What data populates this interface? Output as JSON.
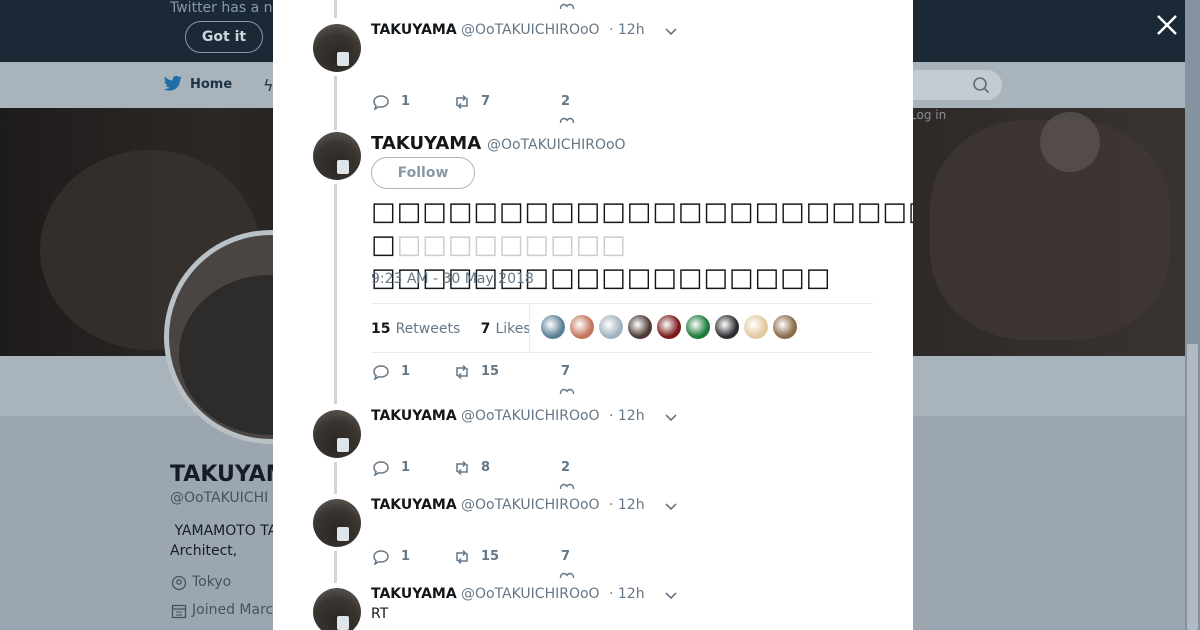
{
  "background": {
    "notice_text": "Twitter has a n",
    "got_it_label": "Got it",
    "nav_home": "Home",
    "login_hint": "Log in",
    "profile": {
      "name": "TAKUYAM",
      "handle": "@OoTAKUICHI",
      "bio": " YAMAMOTO TA\nArchitect,",
      "location": "Tokyo",
      "joined": "Joined Marc"
    }
  },
  "modal": {
    "tweets_before": [
      {
        "name": "TAKUYAMA",
        "handle": "@OoTAKUICHIROoO",
        "time": "· 12h",
        "replies": "1",
        "retweets": "7",
        "likes": "2"
      }
    ],
    "main_tweet": {
      "name": "TAKUYAMA",
      "handle": "@OoTAKUICHIROoO",
      "follow_label": "Follow",
      "text_line1": "□□□□□□□□□□□□□□□□□□□□□□□□□□□□□□",
      "text_line1_faded": "□□□□□□□□□",
      "text_line2": "□□□□□□□□□□□□□□□□□□",
      "date": "9:23 AM - 30 May 2018",
      "retweets_count": "15",
      "retweets_label": "Retweets",
      "likes_count": "7",
      "likes_label": "Likes",
      "liker_colors": [
        "#5b7f95",
        "#c4735a",
        "#9fb2bf",
        "#4a3a32",
        "#7a1a1a",
        "#1c7a3a",
        "#2d2d32",
        "#e2c9a0",
        "#8a6a4a"
      ],
      "replies": "1",
      "retweets": "15",
      "likes": "7"
    },
    "replies": [
      {
        "name": "TAKUYAMA",
        "handle": "@OoTAKUICHIROoO",
        "time": "· 12h",
        "text": "",
        "replies": "1",
        "retweets": "8",
        "likes": "2"
      },
      {
        "name": "TAKUYAMA",
        "handle": "@OoTAKUICHIROoO",
        "time": "· 12h",
        "text": "",
        "replies": "1",
        "retweets": "15",
        "likes": "7"
      },
      {
        "name": "TAKUYAMA",
        "handle": "@OoTAKUICHIROoO",
        "time": "· 12h",
        "text": "RT"
      }
    ]
  }
}
